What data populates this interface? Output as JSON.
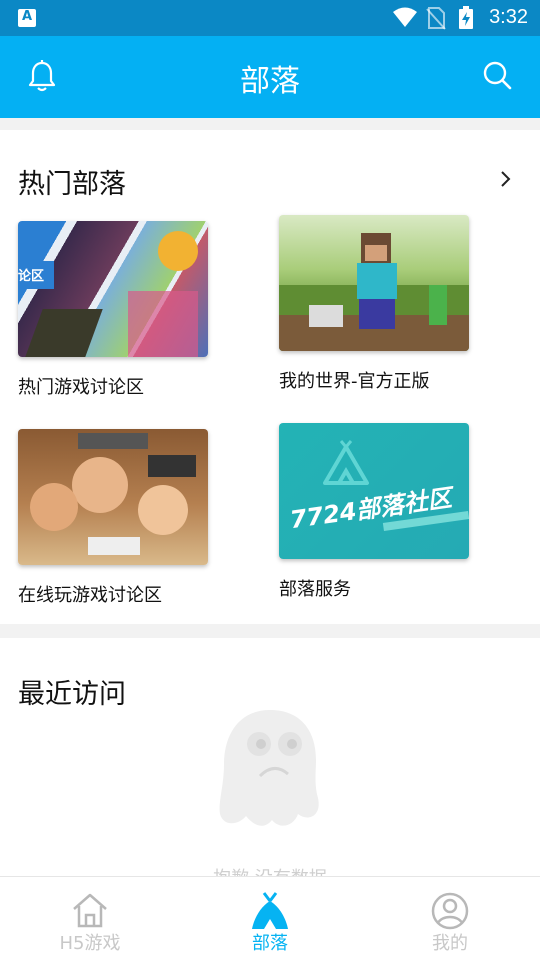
{
  "status_bar": {
    "time": "3:32"
  },
  "header": {
    "title": "部落"
  },
  "hot_section": {
    "title": "热门部落",
    "items": [
      {
        "label": "热门游戏讨论区",
        "thumb_text": "论区"
      },
      {
        "label": "我的世界-官方正版"
      },
      {
        "label": "在线玩游戏讨论区"
      },
      {
        "label": "部落服务",
        "thumb_text": "7724部落社区"
      }
    ]
  },
  "recent_section": {
    "title": "最近访问",
    "empty_text": "抱歉,没有数据"
  },
  "tabbar": {
    "tabs": [
      {
        "label": "H5游戏",
        "icon": "home-icon"
      },
      {
        "label": "部落",
        "icon": "tent-icon"
      },
      {
        "label": "我的",
        "icon": "user-icon"
      }
    ]
  },
  "colors": {
    "accent": "#04b0f3",
    "status": "#0b88c5",
    "active_tab": "#06b3f2",
    "inactive_tab": "#c8c8c8"
  }
}
